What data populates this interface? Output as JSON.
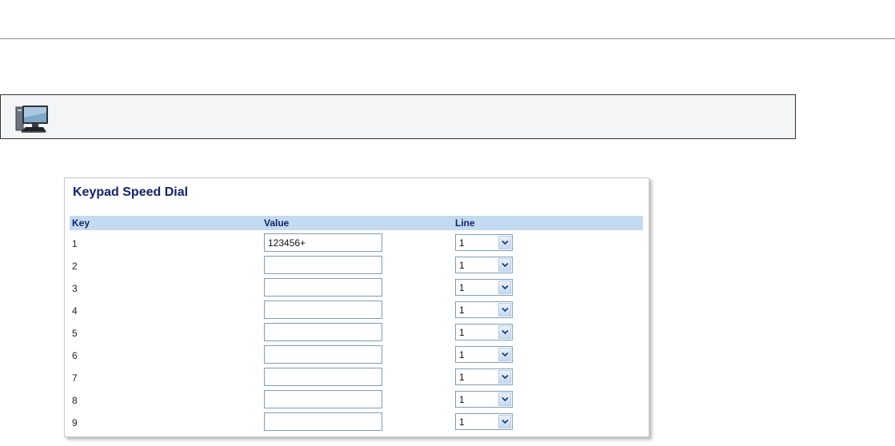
{
  "info_bar": {
    "icon": "computer-monitor-icon"
  },
  "panel": {
    "title": "Keypad Speed Dial",
    "columns": {
      "key": "Key",
      "value": "Value",
      "line": "Line"
    },
    "rows": [
      {
        "key": "1",
        "value": "123456+",
        "line": "1"
      },
      {
        "key": "2",
        "value": "",
        "line": "1"
      },
      {
        "key": "3",
        "value": "",
        "line": "1"
      },
      {
        "key": "4",
        "value": "",
        "line": "1"
      },
      {
        "key": "5",
        "value": "",
        "line": "1"
      },
      {
        "key": "6",
        "value": "",
        "line": "1"
      },
      {
        "key": "7",
        "value": "",
        "line": "1"
      },
      {
        "key": "8",
        "value": "",
        "line": "1"
      },
      {
        "key": "9",
        "value": "",
        "line": "1"
      }
    ]
  },
  "colors": {
    "title": "#13236b",
    "header_bg": "#c3daf0",
    "input_border": "#7f9db9"
  }
}
